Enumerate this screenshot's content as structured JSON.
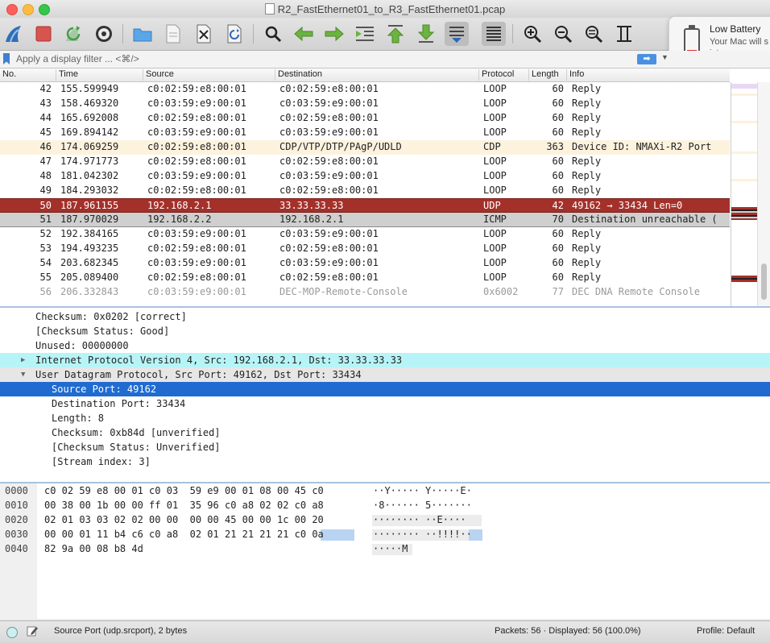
{
  "window": {
    "title": "R2_FastEthernet01_to_R3_FastEthernet01.pcap"
  },
  "toolbar": {
    "icons": [
      "shark-fin-icon",
      "stop-icon",
      "restart-icon",
      "gear-icon",
      "folder-icon",
      "file-icon",
      "close-file-icon",
      "reload-icon",
      "search-icon",
      "arrow-left-icon",
      "arrow-right-icon",
      "jump-to-icon",
      "go-first-icon",
      "go-last-icon",
      "autoscroll-icon",
      "colorize-icon",
      "zoom-in-icon",
      "zoom-out-icon",
      "zoom-normal-icon",
      "resize-columns-icon"
    ]
  },
  "notification": {
    "title": "Low Battery",
    "body_line1": "Your Mac will s",
    "body_line2": "into a power o"
  },
  "filter": {
    "placeholder": "Apply a display filter ... <⌘/>"
  },
  "packet_list": {
    "columns": [
      "No.",
      "Time",
      "Source",
      "Destination",
      "Protocol",
      "Length",
      "Info"
    ],
    "rows": [
      {
        "no": "42",
        "time": "155.599949",
        "src": "c0:02:59:e8:00:01",
        "dst": "c0:02:59:e8:00:01",
        "proto": "LOOP",
        "len": "60",
        "info": "Reply",
        "style": "normal"
      },
      {
        "no": "43",
        "time": "158.469320",
        "src": "c0:03:59:e9:00:01",
        "dst": "c0:03:59:e9:00:01",
        "proto": "LOOP",
        "len": "60",
        "info": "Reply",
        "style": "normal"
      },
      {
        "no": "44",
        "time": "165.692008",
        "src": "c0:02:59:e8:00:01",
        "dst": "c0:02:59:e8:00:01",
        "proto": "LOOP",
        "len": "60",
        "info": "Reply",
        "style": "normal"
      },
      {
        "no": "45",
        "time": "169.894142",
        "src": "c0:03:59:e9:00:01",
        "dst": "c0:03:59:e9:00:01",
        "proto": "LOOP",
        "len": "60",
        "info": "Reply",
        "style": "normal"
      },
      {
        "no": "46",
        "time": "174.069259",
        "src": "c0:02:59:e8:00:01",
        "dst": "CDP/VTP/DTP/PAgP/UDLD",
        "proto": "CDP",
        "len": "363",
        "info": "Device ID: NMAXi-R2  Port",
        "style": "cdp"
      },
      {
        "no": "47",
        "time": "174.971773",
        "src": "c0:02:59:e8:00:01",
        "dst": "c0:02:59:e8:00:01",
        "proto": "LOOP",
        "len": "60",
        "info": "Reply",
        "style": "normal"
      },
      {
        "no": "48",
        "time": "181.042302",
        "src": "c0:03:59:e9:00:01",
        "dst": "c0:03:59:e9:00:01",
        "proto": "LOOP",
        "len": "60",
        "info": "Reply",
        "style": "normal"
      },
      {
        "no": "49",
        "time": "184.293032",
        "src": "c0:02:59:e8:00:01",
        "dst": "c0:02:59:e8:00:01",
        "proto": "LOOP",
        "len": "60",
        "info": "Reply",
        "style": "normal"
      },
      {
        "no": "50",
        "time": "187.961155",
        "src": "192.168.2.1",
        "dst": "33.33.33.33",
        "proto": "UDP",
        "len": "42",
        "info": "49162 → 33434 Len=0",
        "style": "sel"
      },
      {
        "no": "51",
        "time": "187.970029",
        "src": "192.168.2.2",
        "dst": "192.168.2.1",
        "proto": "ICMP",
        "len": "70",
        "info": "Destination unreachable (",
        "style": "icmp"
      },
      {
        "no": "52",
        "time": "192.384165",
        "src": "c0:03:59:e9:00:01",
        "dst": "c0:03:59:e9:00:01",
        "proto": "LOOP",
        "len": "60",
        "info": "Reply",
        "style": "normal"
      },
      {
        "no": "53",
        "time": "194.493235",
        "src": "c0:02:59:e8:00:01",
        "dst": "c0:02:59:e8:00:01",
        "proto": "LOOP",
        "len": "60",
        "info": "Reply",
        "style": "normal"
      },
      {
        "no": "54",
        "time": "203.682345",
        "src": "c0:03:59:e9:00:01",
        "dst": "c0:03:59:e9:00:01",
        "proto": "LOOP",
        "len": "60",
        "info": "Reply",
        "style": "normal"
      },
      {
        "no": "55",
        "time": "205.089400",
        "src": "c0:02:59:e8:00:01",
        "dst": "c0:02:59:e8:00:01",
        "proto": "LOOP",
        "len": "60",
        "info": "Reply",
        "style": "normal"
      },
      {
        "no": "56",
        "time": "206.332843",
        "src": "c0:03:59:e9:00:01",
        "dst": "DEC-MOP-Remote-Console",
        "proto": "0x6002",
        "len": "77",
        "info": "DEC DNA Remote Console",
        "style": "dim"
      }
    ]
  },
  "details": {
    "lines": [
      {
        "text": "Checksum: 0x0202 [correct]",
        "indent": 44,
        "style": "normal",
        "toggle": ""
      },
      {
        "text": "[Checksum Status: Good]",
        "indent": 44,
        "style": "normal",
        "toggle": ""
      },
      {
        "text": "Unused: 00000000",
        "indent": 44,
        "style": "normal",
        "toggle": ""
      },
      {
        "text": "Internet Protocol Version 4, Src: 192.168.2.1, Dst: 33.33.33.33",
        "indent": 44,
        "style": "ip",
        "toggle": "▶"
      },
      {
        "text": "User Datagram Protocol, Src Port: 49162, Dst Port: 33434",
        "indent": 44,
        "style": "udp",
        "toggle": "▼"
      },
      {
        "text": "Source Port: 49162",
        "indent": 64,
        "style": "hl",
        "toggle": ""
      },
      {
        "text": "Destination Port: 33434",
        "indent": 64,
        "style": "normal",
        "toggle": ""
      },
      {
        "text": "Length: 8",
        "indent": 64,
        "style": "normal",
        "toggle": ""
      },
      {
        "text": "Checksum: 0xb84d [unverified]",
        "indent": 64,
        "style": "normal",
        "toggle": ""
      },
      {
        "text": "[Checksum Status: Unverified]",
        "indent": 64,
        "style": "normal",
        "toggle": ""
      },
      {
        "text": "[Stream index: 3]",
        "indent": 64,
        "style": "normal",
        "toggle": ""
      }
    ]
  },
  "bytes": {
    "rows": [
      {
        "offset": "0000",
        "hex": "c0 02 59 e8 00 01 c0 03  59 e9 00 01 08 00 45 c0",
        "ascii": "··Y····· Y·····E·"
      },
      {
        "offset": "0010",
        "hex": "00 38 00 1b 00 00 ff 01  35 96 c0 a8 02 02 c0 a8",
        "ascii": "·8······ 5·······"
      },
      {
        "offset": "0020",
        "hex": "02 01 03 03 02 02 00 00  00 00 45 00 00 1c 00 20",
        "ascii": "········ ··E····"
      },
      {
        "offset": "0030",
        "hex": "00 00 01 11 b4 c6 c0 a8  02 01 21 21 21 21 c0 0a",
        "ascii": "········ ··!!!!··"
      },
      {
        "offset": "0040",
        "hex": "82 9a 00 08 b8 4d",
        "ascii": "·····M"
      }
    ]
  },
  "status": {
    "field": "Source Port (udp.srcport), 2 bytes",
    "packets": "Packets: 56 · Displayed: 56 (100.0%)",
    "profile": "Profile: Default"
  },
  "colors": {
    "selected_row": "#a4302a",
    "icmp_row": "#cfcfcf",
    "cdp_row": "#fdf2de",
    "ip_detail": "#b7f4f7",
    "detail_highlight": "#1f6bd0"
  }
}
